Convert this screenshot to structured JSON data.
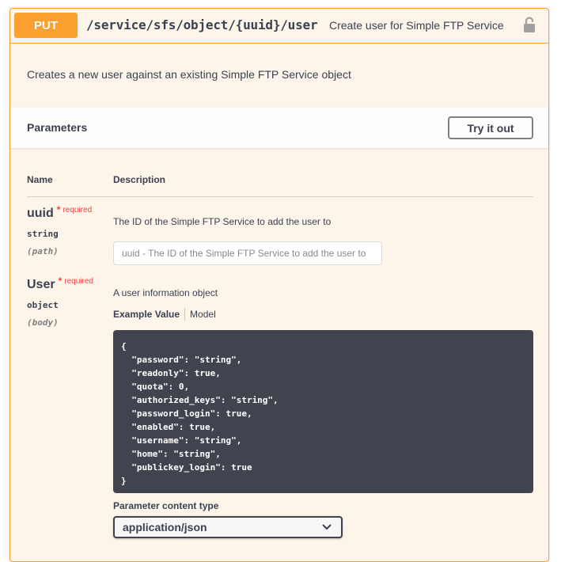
{
  "operation": {
    "method": "PUT",
    "path": "/service/sfs/object/{uuid}/user",
    "summary": "Create user for Simple FTP Service",
    "lock_icon": "lock-icon",
    "description": "Creates a new user against an existing Simple FTP Service object"
  },
  "parameters_section": {
    "title": "Parameters",
    "try_button": "Try it out",
    "col_name": "Name",
    "col_description": "Description"
  },
  "params": [
    {
      "name": "uuid",
      "required_star": "*",
      "required_text": "required",
      "type": "string",
      "in": "(path)",
      "description": "The ID of the Simple FTP Service to add the user to",
      "placeholder": "uuid - The ID of the Simple FTP Service to add the user to"
    },
    {
      "name": "User",
      "required_star": "*",
      "required_text": "required",
      "type": "object",
      "in": "(body)",
      "description": "A user information object"
    }
  ],
  "body": {
    "tab_example": "Example Value",
    "tab_model": "Model",
    "example_json": "{\n  \"password\": \"string\",\n  \"readonly\": true,\n  \"quota\": 0,\n  \"authorized_keys\": \"string\",\n  \"password_login\": true,\n  \"enabled\": true,\n  \"username\": \"string\",\n  \"home\": \"string\",\n  \"publickey_login\": true\n}",
    "content_type_label": "Parameter content type",
    "content_type_value": "application/json",
    "chevron_icon": "chevron-down-icon"
  },
  "colors": {
    "put_accent": "#fca130",
    "block_bg": "#fdf5ea",
    "code_bg": "#41444e",
    "required": "#f93e3e"
  }
}
